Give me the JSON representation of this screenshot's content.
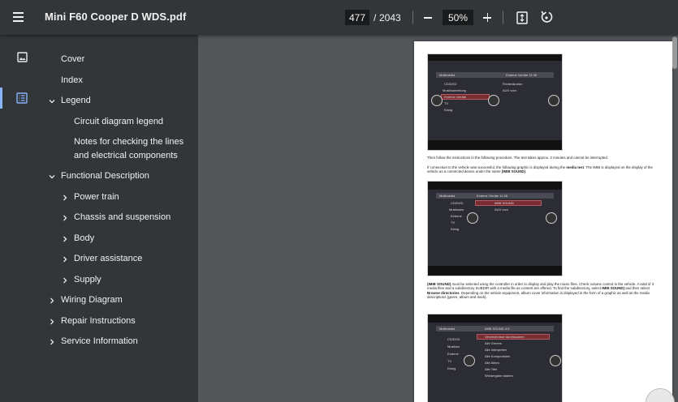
{
  "toolbar": {
    "title": "Mini F60 Cooper D WDS.pdf",
    "page_current": "477",
    "page_separator": "/",
    "page_total": "2043",
    "zoom": "50%"
  },
  "sidebar": {
    "outline": [
      {
        "label": "Cover"
      },
      {
        "label": "Index"
      },
      {
        "label": "Legend"
      },
      {
        "label": "Circuit diagram legend"
      },
      {
        "label": "Notes for checking the lines"
      },
      {
        "label": "and electrical components"
      },
      {
        "label": "Functional Description"
      },
      {
        "label": "Power train"
      },
      {
        "label": "Chassis and suspension"
      },
      {
        "label": "Body"
      },
      {
        "label": "Driver assistance"
      },
      {
        "label": "Supply"
      },
      {
        "label": "Wiring Diagram"
      },
      {
        "label": "Repair Instructions"
      },
      {
        "label": "Service Information"
      }
    ]
  },
  "document": {
    "para1": "Then follow the instructions in the following procedure. The test takes approx. 2 minutes and cannot be interrupted.",
    "para2_a": "If connection to the vehicle was successful, the following graphic is displayed during the ",
    "para2_b": "media test",
    "para2_c": ". The IMIB is displayed on the display of the vehicle as a connected device under the name ",
    "para2_d": "(IMIB SOUND)",
    "para2_e": ".",
    "para3_a": "(IMIB SOUND)",
    "para3_b": " must be selected using the controller in order to display and play the music files. Check volume control in the vehicle. A total of 3 media files and a subdirectory SUBDIR with a media file as content are offered. To find the subdirectory, select ",
    "para3_c": "IMIB SOUND)",
    "para3_d": " and then select ",
    "para3_e": "Browse directories",
    "para3_f": ". Depending on the vehicle equipment, album cover information is displayed in the form of a graphic as well as the media descriptions (genre, album and track).",
    "screen1": {
      "header_left": "Multimedia",
      "header_right": "Externe Geräte   11:36",
      "menu": [
        "CD/DVD",
        "Musiksammlung",
        "Externe Geräte",
        "TV",
        "Klang"
      ],
      "right": [
        "Richtmikrofon",
        "AUX vorn"
      ]
    },
    "screen2": {
      "header_left": "Multimedia",
      "header_right": "Externe Geräte   11:36",
      "menu": [
        "CD/DVD",
        "Musiksam",
        "Externe",
        "TV",
        "Klang"
      ],
      "right": [
        "IMIB SOUND",
        "AUX vorn"
      ]
    },
    "screen3": {
      "header_left": "Multimedia",
      "header_right": "IMIB SOUND   4:5",
      "menu": [
        "CD/DVD",
        "Musiksa",
        "Externe",
        "TV",
        "Klang"
      ],
      "right": [
        "Verzeichnisse durchsuchen",
        "Alle Genres",
        "Alle Interpreten",
        "Alle Komponisten",
        "Alle Alben",
        "Alle Titel",
        "Wiedergabe starten"
      ]
    }
  }
}
